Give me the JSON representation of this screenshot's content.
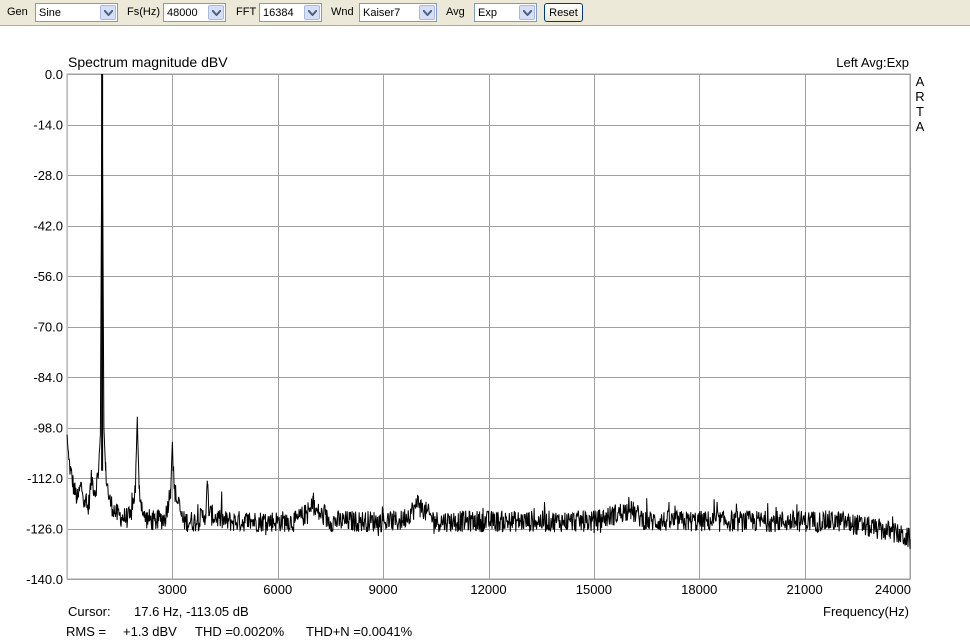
{
  "toolbar": {
    "gen": {
      "label": "Gen",
      "value": "Sine"
    },
    "fs": {
      "label": "Fs(Hz)",
      "value": "48000"
    },
    "fft": {
      "label": "FFT",
      "value": "16384"
    },
    "wnd": {
      "label": "Wnd",
      "value": "Kaiser7"
    },
    "avg": {
      "label": "Avg",
      "value": "Exp"
    },
    "reset_label": "Reset"
  },
  "plot": {
    "title": "Spectrum magnitude dBV",
    "channel_info": "Left  Avg:Exp",
    "brand_letters": [
      "A",
      "R",
      "T",
      "A"
    ],
    "cursor_label": "Cursor:",
    "cursor_value": "17.6 Hz, -113.05 dB",
    "xlabel": "Frequency(Hz)",
    "rms_label": "RMS =",
    "rms_value": "+1.3 dBV",
    "thd": "THD =0.0020%",
    "thdn": "THD+N =0.0041%"
  },
  "colors": {
    "trace": "#000000",
    "grid": "#a0a0a0",
    "yaxis_line": "#c8c864",
    "stats_text": "#b00000",
    "toolbar_bg": "#ece9d8"
  },
  "chart_data": {
    "type": "line",
    "title": "Spectrum magnitude dBV",
    "xlabel": "Frequency(Hz)",
    "ylabel": "",
    "xlim": [
      0,
      24000
    ],
    "ylim": [
      -140,
      0
    ],
    "x_ticks": [
      3000,
      6000,
      9000,
      12000,
      15000,
      18000,
      21000,
      24000
    ],
    "x_tick_labels": [
      "3000",
      "6000",
      "9000",
      "12000",
      "15000",
      "18000",
      "21000",
      "24000"
    ],
    "y_ticks": [
      0,
      -14,
      -28,
      -42,
      -56,
      -70,
      -84,
      -98,
      -112,
      -126,
      -140
    ],
    "y_tick_labels": [
      "0.0",
      "-14.0",
      "-28.0",
      "-42.0",
      "-56.0",
      "-70.0",
      "-84.0",
      "-98.0",
      "-112.0",
      "-126.0",
      "-140.0"
    ],
    "grid": true,
    "series": [
      {
        "x": [
          0,
          50,
          100,
          200,
          300,
          400,
          500,
          600,
          700,
          800,
          900,
          950,
          1000,
          1050,
          1100,
          1200,
          1400,
          1600,
          1800,
          1950,
          2000,
          2050,
          2200,
          2500,
          2800,
          2950,
          3000,
          3050,
          3300,
          3700,
          3950,
          4000,
          4050,
          4500,
          5000,
          5500,
          6000,
          6500,
          6950,
          7000,
          7050,
          7500,
          8000,
          8500,
          9000,
          9500,
          9950,
          10000,
          10050,
          10500,
          11000,
          12000,
          13000,
          14000,
          15000,
          15950,
          16000,
          16050,
          16500,
          17000,
          18000,
          19000,
          20000,
          21000,
          21500,
          22000,
          22500,
          23000,
          23500,
          24000
        ],
        "values": [
          -100,
          -107,
          -110,
          -115,
          -118,
          -114,
          -118,
          -121,
          -112,
          -116,
          -110,
          -100,
          0,
          -98,
          -110,
          -118,
          -122,
          -123,
          -123,
          -115,
          -95,
          -115,
          -123,
          -124,
          -123,
          -115,
          -102,
          -115,
          -124,
          -124,
          -122,
          -114,
          -122,
          -124,
          -124,
          -124,
          -124,
          -124,
          -121,
          -117,
          -121,
          -124,
          -124,
          -124,
          -124,
          -124,
          -120,
          -117,
          -120,
          -124,
          -124,
          -124,
          -124,
          -124,
          -124,
          -121,
          -118,
          -121,
          -124,
          -124,
          -124,
          -124,
          -124,
          -124,
          -124,
          -124,
          -125,
          -126,
          -127,
          -129
        ]
      }
    ]
  }
}
